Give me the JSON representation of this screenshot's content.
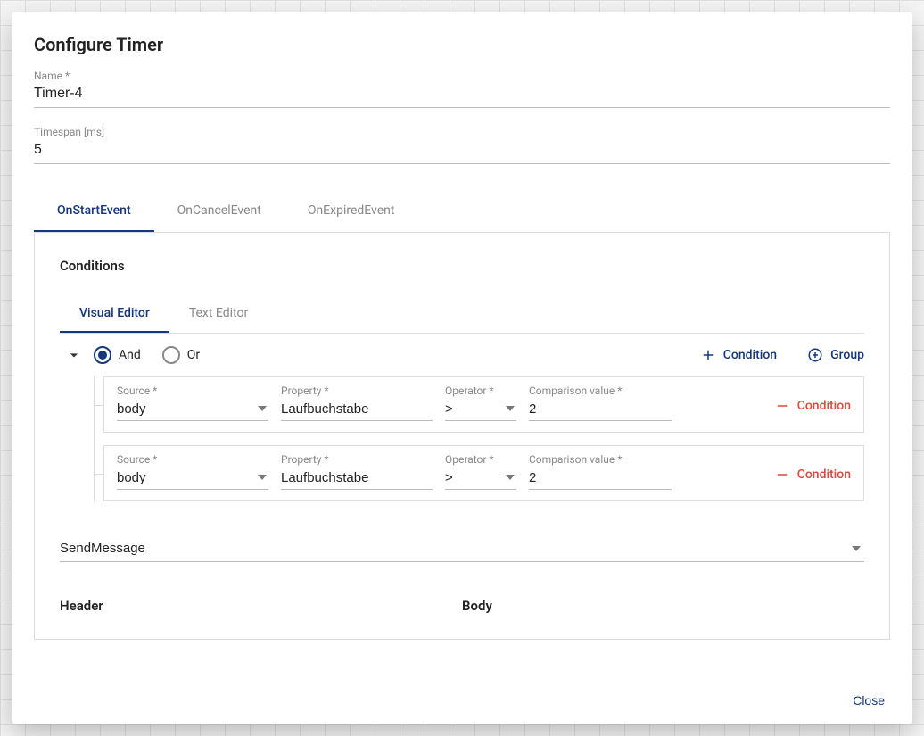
{
  "dialog": {
    "title": "Configure Timer",
    "close": "Close"
  },
  "fields": {
    "name": {
      "label": "Name *",
      "value": "Timer-4"
    },
    "timespan": {
      "label": "Timespan [ms]",
      "value": "5"
    }
  },
  "tabs": {
    "start": "OnStartEvent",
    "cancel": "OnCancelEvent",
    "expired": "OnExpiredEvent"
  },
  "conditions": {
    "title": "Conditions",
    "subtabs": {
      "visual": "Visual Editor",
      "text": "Text Editor"
    },
    "logic": {
      "and": "And",
      "or": "Or"
    },
    "addCondition": "Condition",
    "addGroup": "Group",
    "removeCondition": "Condition",
    "labels": {
      "source": "Source *",
      "property": "Property *",
      "operator": "Operator *",
      "comparison": "Comparison value *"
    },
    "rows": [
      {
        "source": "body",
        "property": "Laufbuchstabe",
        "operator": ">",
        "comparison": "2"
      },
      {
        "source": "body",
        "property": "Laufbuchstabe",
        "operator": ">",
        "comparison": "2"
      }
    ]
  },
  "action": {
    "value": "SendMessage"
  },
  "columns": {
    "header": "Header",
    "body": "Body"
  }
}
